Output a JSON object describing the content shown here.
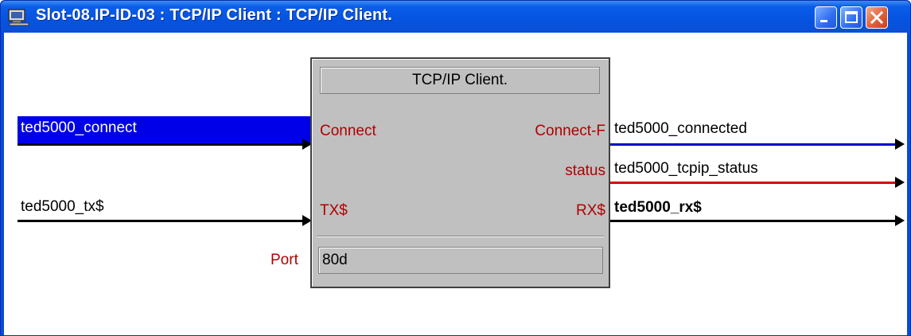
{
  "window": {
    "title": "Slot-08.IP-ID-03 : TCP/IP Client : TCP/IP Client."
  },
  "symbol": {
    "title": "TCP/IP Client.",
    "input_pins": [
      "Connect",
      "TX$"
    ],
    "output_pins": [
      "Connect-F",
      "status",
      "RX$"
    ],
    "param_label": "Port",
    "param_value": "80d"
  },
  "inputs": [
    {
      "signal": "ted5000_connect",
      "pin": "Connect",
      "selected": true
    },
    {
      "signal": "ted5000_tx$",
      "pin": "TX$",
      "selected": false
    }
  ],
  "outputs": [
    {
      "signal": "ted5000_connected",
      "pin": "Connect-F",
      "color": "#0000cc",
      "bold": false
    },
    {
      "signal": "ted5000_tcpip_status",
      "pin": "status",
      "color": "#e00000",
      "bold": false
    },
    {
      "signal": "ted5000_rx$",
      "pin": "RX$",
      "color": "#000000",
      "bold": true
    }
  ],
  "colors": {
    "titlebar": "#0a5ee9",
    "selection": "#0000e8",
    "pin_label": "#b00000",
    "symbol_bg": "#c0c0c0"
  },
  "icons": [
    "program-window-icon",
    "minimize-icon",
    "maximize-icon",
    "close-icon"
  ]
}
